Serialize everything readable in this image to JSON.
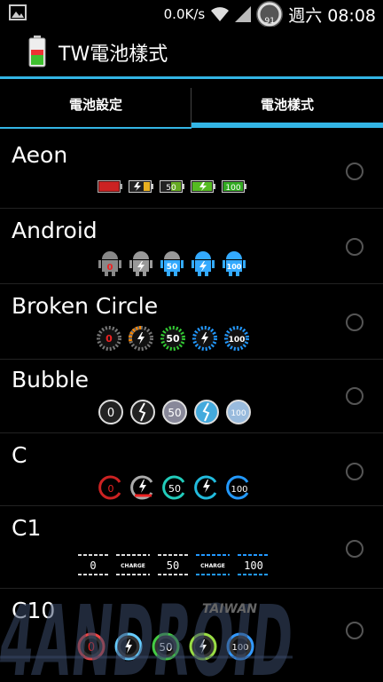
{
  "statusbar": {
    "speed": "0.0K/s",
    "battery_level": "91",
    "time": "週六 08:08"
  },
  "app": {
    "title": "TW電池樣式"
  },
  "tabs": [
    {
      "label": "電池設定",
      "selected": false
    },
    {
      "label": "電池樣式",
      "selected": true
    }
  ],
  "styles": [
    {
      "name": "Aeon",
      "icon_labels": [
        "50",
        "100"
      ]
    },
    {
      "name": "Android",
      "icon_labels": [
        "0",
        "50",
        "100"
      ]
    },
    {
      "name": "Broken Circle",
      "icon_labels": [
        "0",
        "50",
        "100"
      ]
    },
    {
      "name": "Bubble",
      "icon_labels": [
        "0",
        "50",
        "100"
      ]
    },
    {
      "name": "C",
      "icon_labels": [
        "0",
        "50",
        "100"
      ]
    },
    {
      "name": "C1",
      "icon_labels": [
        "0",
        "CHARGE",
        "50",
        "CHARGE",
        "100"
      ]
    },
    {
      "name": "C10",
      "icon_labels": [
        "0",
        "50",
        "100"
      ]
    }
  ],
  "watermark": {
    "brand": "4ANDROID",
    "region": "TAIWAN"
  },
  "colors": {
    "accent": "#33b5e5",
    "background": "#000000",
    "text": "#ffffff"
  }
}
